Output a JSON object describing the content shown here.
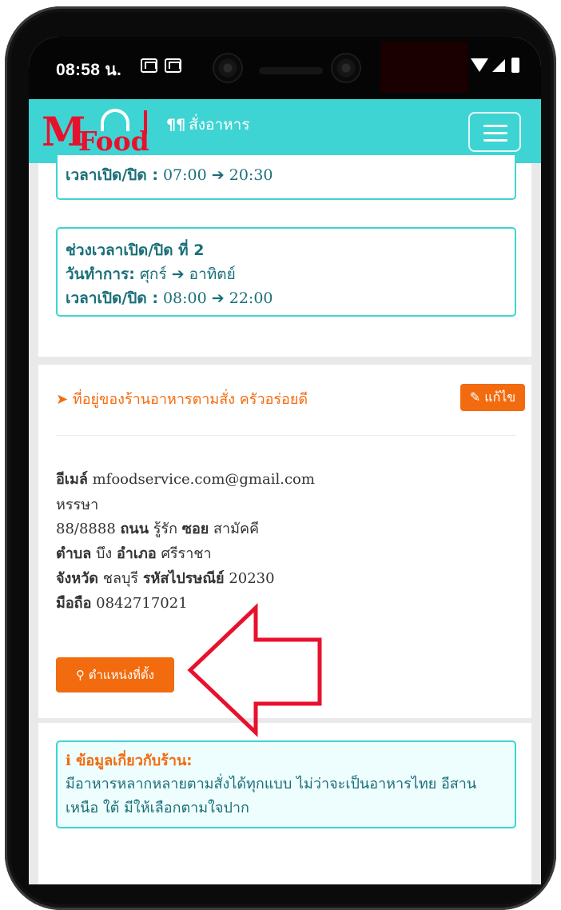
{
  "status_bar": {
    "time": "08:58 น."
  },
  "navbar": {
    "logo_m": "M",
    "logo_food": "Food",
    "brand_text": "สั่งอาหาร"
  },
  "hours": {
    "slot1": {
      "time_label": "เวลาเปิด/ปิด :",
      "open": "07:00",
      "close": "20:30"
    },
    "slot2": {
      "title": "ช่วงเวลาเปิด/ปิด ที่ 2",
      "days_label": "วันทำการ:",
      "day_from": "ศุกร์",
      "day_to": "อาทิตย์",
      "time_label": "เวลาเปิด/ปิด :",
      "open": "08:00",
      "close": "22:00"
    }
  },
  "address": {
    "title": "ที่อยู่ของร้านอาหารตามสั่ง ครัวอร่อยดี",
    "edit_label": "แก้ไข",
    "email_label": "อีเมล์",
    "email": "mfoodservice.com@gmail.com",
    "name": "หรรษา",
    "house_no": "88/8888",
    "road_label": "ถนน",
    "road": "รู้รัก",
    "soi_label": "ซอย",
    "soi": "สามัคคี",
    "subdistrict_label": "ตำบล",
    "subdistrict": "บึง",
    "district_label": "อำเภอ",
    "district": "ศรีราชา",
    "province_label": "จังหวัด",
    "province": "ชลบุรี",
    "postcode_label": "รหัสไปรษณีย์",
    "postcode": "20230",
    "mobile_label": "มือถือ",
    "mobile": "0842717021",
    "location_button": "ตำแหน่งที่ตั้ง"
  },
  "info": {
    "title": "ข้อมูลเกี่ยวกับร้าน:",
    "body": "มีอาหารหลากหลายตามสั่งได้ทุกแบบ ไม่ว่าจะเป็นอาหารไทย อีสาน เหนือ ใต้ มีให้เลือกตามใจปาก"
  },
  "colors": {
    "accent": "#3fd4d4",
    "orange": "#f26b0f",
    "brand_red": "#e8112d",
    "teal_text": "#1a6f79",
    "arrow": "#e8112d"
  },
  "icons": [
    "location-arrow-icon",
    "pencil-icon",
    "map-marker-icon",
    "info-circle-icon",
    "arrow-right-icon",
    "menu-icon",
    "utensils-icon"
  ]
}
